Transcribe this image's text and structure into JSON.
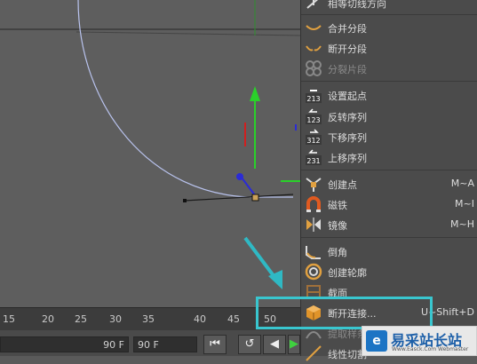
{
  "viewport": {},
  "timeline": {
    "ticks": [
      "15",
      "20",
      "25",
      "30",
      "35",
      "40",
      "45",
      "50"
    ]
  },
  "playback": {
    "end_frame": "90 F",
    "frame_field": "90 F"
  },
  "menu": {
    "items": [
      {
        "label": "相等切线方向",
        "shortcut": "",
        "icon": "tangent-icon",
        "disabled": false
      },
      {
        "label": "合并分段",
        "shortcut": "",
        "icon": "join-segment-icon",
        "disabled": false
      },
      {
        "label": "断开分段",
        "shortcut": "",
        "icon": "break-segment-icon",
        "disabled": false
      },
      {
        "label": "分裂片段",
        "shortcut": "",
        "icon": "explode-segments-icon",
        "disabled": true
      },
      {
        "label": "设置起点",
        "shortcut": "",
        "icon": "set-start-icon",
        "disabled": false
      },
      {
        "label": "反转序列",
        "shortcut": "",
        "icon": "reverse-sequence-icon",
        "disabled": false
      },
      {
        "label": "下移序列",
        "shortcut": "",
        "icon": "move-down-sequence-icon",
        "disabled": false
      },
      {
        "label": "上移序列",
        "shortcut": "",
        "icon": "move-up-sequence-icon",
        "disabled": false
      },
      {
        "label": "创建点",
        "shortcut": "M~A",
        "icon": "create-point-icon",
        "disabled": false
      },
      {
        "label": "磁铁",
        "shortcut": "M~I",
        "icon": "magnet-icon",
        "disabled": false
      },
      {
        "label": "镜像",
        "shortcut": "M~H",
        "icon": "mirror-icon",
        "disabled": false
      },
      {
        "label": "倒角",
        "shortcut": "",
        "icon": "chamfer-icon",
        "disabled": false
      },
      {
        "label": "创建轮廓",
        "shortcut": "",
        "icon": "create-outline-icon",
        "disabled": false
      },
      {
        "label": "截面",
        "shortcut": "",
        "icon": "cross-section-icon",
        "disabled": false
      },
      {
        "label": "断开连接...",
        "shortcut": "U~Shift+D",
        "icon": "disconnect-icon",
        "disabled": false
      },
      {
        "label": "提取样条",
        "shortcut": "",
        "icon": "extract-spline-icon",
        "disabled": false
      },
      {
        "label": "线性切割",
        "shortcut": "",
        "icon": "line-cut-icon",
        "disabled": false
      }
    ]
  },
  "watermark": {
    "logo_char": "e",
    "title": "易采站长站",
    "subtitle": "Www.Easck.Com  Webmaster"
  },
  "colors": {
    "highlight": "#39c6cf",
    "arrow": "#2fb9c4"
  }
}
